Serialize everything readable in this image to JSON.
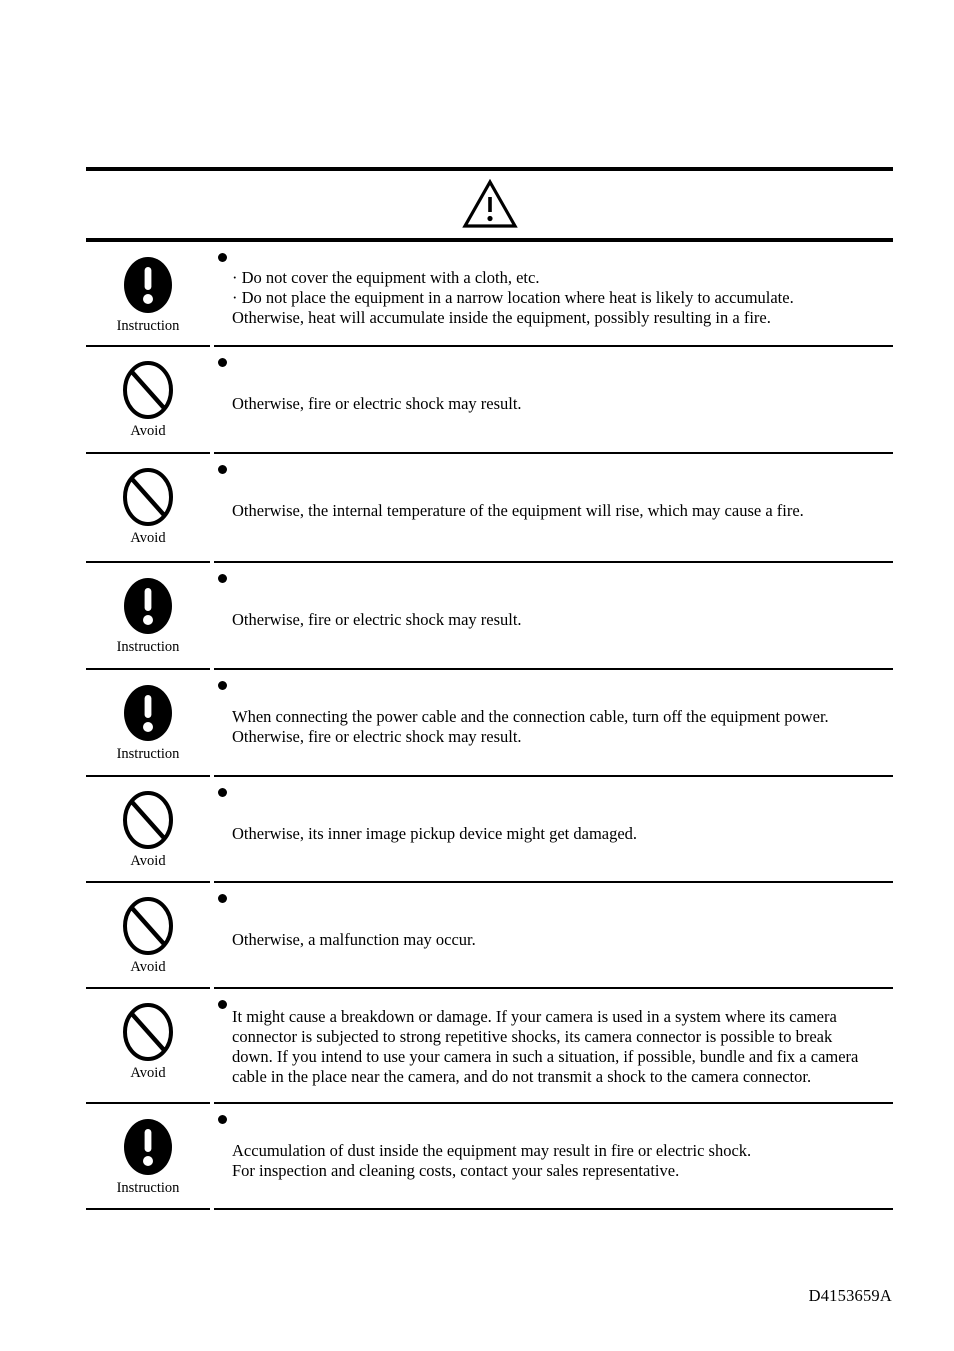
{
  "document": {
    "footer_code": "D4153659A",
    "header_symbol": "warning-triangle"
  },
  "icons": {
    "instruction": {
      "name": "instruction-icon",
      "label": "Instruction"
    },
    "avoid": {
      "name": "avoid-icon",
      "label": "Avoid"
    }
  },
  "rows": [
    {
      "icon": "instruction",
      "icon_label": "Instruction",
      "lines": [
        "·  Do not cover the equipment with a cloth, etc.",
        "·  Do not place the equipment in a narrow location where heat is likely to accumulate.",
        "Otherwise, heat will accumulate inside the equipment, possibly resulting in a fire."
      ]
    },
    {
      "icon": "avoid",
      "icon_label": "Avoid",
      "lines": [
        "Otherwise, fire or electric shock may result."
      ]
    },
    {
      "icon": "avoid",
      "icon_label": "Avoid",
      "lines": [
        "Otherwise, the internal temperature of the equipment will rise, which may cause a fire."
      ]
    },
    {
      "icon": "instruction",
      "icon_label": "Instruction",
      "lines": [
        "Otherwise, fire or electric shock may result."
      ]
    },
    {
      "icon": "instruction",
      "icon_label": "Instruction",
      "lines": [
        "When connecting the power cable and the connection cable, turn off the equipment power.",
        "Otherwise, fire or electric shock may result."
      ]
    },
    {
      "icon": "avoid",
      "icon_label": "Avoid",
      "lines": [
        "Otherwise, its inner image pickup device might get damaged."
      ]
    },
    {
      "icon": "avoid",
      "icon_label": "Avoid",
      "lines": [
        "Otherwise, a malfunction may occur."
      ]
    },
    {
      "icon": "avoid",
      "icon_label": "Avoid",
      "lines": [
        "It might cause a breakdown or damage. If your camera is used in a system where its camera",
        "connector is subjected to strong repetitive shocks, its camera connector is possible to break",
        "down. If you intend to use your camera in such a situation, if possible, bundle and fix a camera",
        "cable in the place near the camera, and do not transmit a shock to the camera connector."
      ]
    },
    {
      "icon": "instruction",
      "icon_label": "Instruction",
      "lines": [
        "Accumulation of dust inside the equipment may result in fire or electric shock.",
        "For inspection and cleaning costs, contact your sales representative."
      ]
    }
  ],
  "colors": {
    "ink": "#000000",
    "paper": "#ffffff"
  }
}
